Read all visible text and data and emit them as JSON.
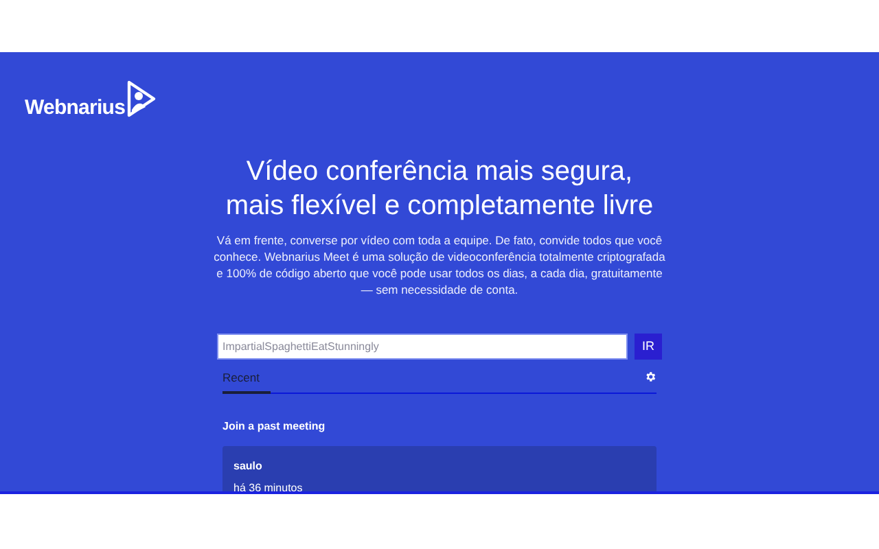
{
  "logo": {
    "text": "Webnarius"
  },
  "hero": {
    "title_lines": [
      "Vídeo conferência mais segura,",
      "mais flexível e completamente livre"
    ],
    "description": "Vá em frente, converse por vídeo com toda a equipe. De fato, convide todos que você conhece. Webnarius Meet é uma solução de videoconferência totalmente criptografada e 100% de código aberto que você pode usar todos os dias, a cada dia, gratuitamente — sem necessidade de conta."
  },
  "room_field": {
    "placeholder": "ImpartialSpaghettiEatStunningly"
  },
  "go_button": "IR",
  "tabs": [
    {
      "label": "Recent",
      "selected": true
    }
  ],
  "section_title": "Join a past meeting",
  "meetings": [
    {
      "name": "saulo",
      "time": "há 36 minutos"
    }
  ]
}
